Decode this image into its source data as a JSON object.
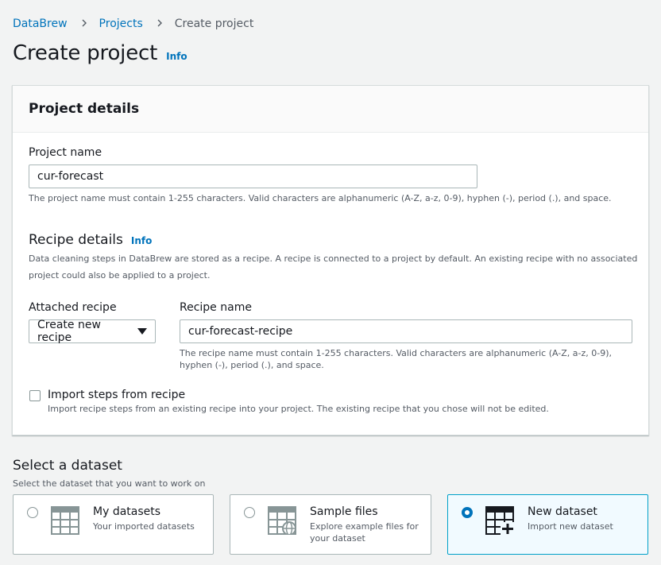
{
  "breadcrumb": {
    "items": [
      "DataBrew",
      "Projects",
      "Create project"
    ]
  },
  "page": {
    "title": "Create project",
    "info": "Info"
  },
  "project_details": {
    "header": "Project details",
    "name_label": "Project name",
    "name_value": "cur-forecast",
    "name_hint": "The project name must contain 1-255 characters. Valid characters are alphanumeric (A-Z, a-z, 0-9), hyphen (-), period (.), and space."
  },
  "recipe_details": {
    "heading": "Recipe details",
    "info": "Info",
    "desc_line1": "Data cleaning steps in DataBrew are stored as a recipe. A recipe is connected to a project by default. An existing recipe with no associated",
    "desc_line2": "project could also be applied to a project.",
    "attached_label": "Attached recipe",
    "attached_value": "Create new recipe",
    "recipe_name_label": "Recipe name",
    "recipe_name_value": "cur-forecast-recipe",
    "recipe_hint_line1": "The recipe name must contain 1-255 characters. Valid characters are alphanumeric (A-Z, a-z, 0-9),",
    "recipe_hint_line2": "hyphen (-), period (.), and space.",
    "import_label": "Import steps from recipe",
    "import_desc": "Import recipe steps from an existing recipe into your project. The existing recipe that you chose will not be edited.",
    "import_checked": false
  },
  "dataset": {
    "title": "Select a dataset",
    "desc": "Select the dataset that you want to work on",
    "options": [
      {
        "title": "My datasets",
        "desc": "Your imported datasets",
        "icon": "table-icon",
        "selected": false
      },
      {
        "title": "Sample files",
        "desc": "Explore example files for your dataset",
        "icon": "table-globe-icon",
        "selected": false
      },
      {
        "title": "New dataset",
        "desc": "Import new dataset",
        "icon": "table-plus-icon",
        "selected": true
      }
    ]
  },
  "colors": {
    "link": "#0073bb",
    "selected_border": "#00a1c9",
    "selected_bg": "#f1faff",
    "page_bg": "#f2f3f3"
  }
}
